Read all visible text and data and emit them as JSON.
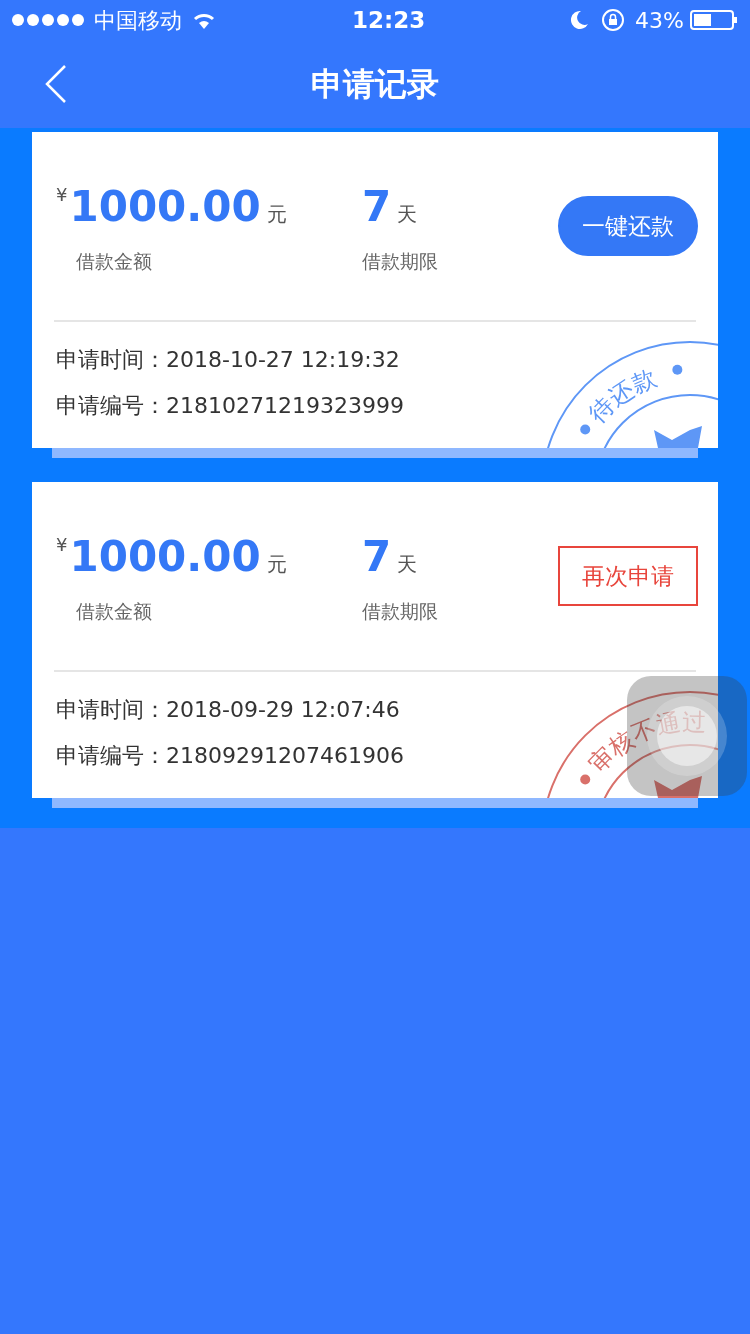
{
  "status_bar": {
    "carrier": "中国移动",
    "time": "12:23",
    "battery": "43%"
  },
  "nav": {
    "title": "申请记录"
  },
  "records": [
    {
      "currency": "¥",
      "amount": "1000.00",
      "amount_unit": "元",
      "amount_label": "借款金额",
      "term": "7",
      "term_unit": "天",
      "term_label": "借款期限",
      "button": {
        "label": "一键还款",
        "kind": "filled"
      },
      "fields": [
        {
          "label": "申请时间：",
          "value": "2018-10-27 12:19:32"
        },
        {
          "label": "申请编号：",
          "value": "21810271219323999"
        }
      ],
      "stamp": {
        "text": "待还款",
        "kind": "pending"
      }
    },
    {
      "currency": "¥",
      "amount": "1000.00",
      "amount_unit": "元",
      "amount_label": "借款金额",
      "term": "7",
      "term_unit": "天",
      "term_label": "借款期限",
      "button": {
        "label": "再次申请",
        "kind": "outline"
      },
      "fields": [
        {
          "label": "申请时间：",
          "value": "2018-09-29 12:07:46"
        },
        {
          "label": "申请编号：",
          "value": "21809291207461906"
        }
      ],
      "stamp": {
        "text": "审核不通过",
        "kind": "rejected"
      }
    }
  ]
}
